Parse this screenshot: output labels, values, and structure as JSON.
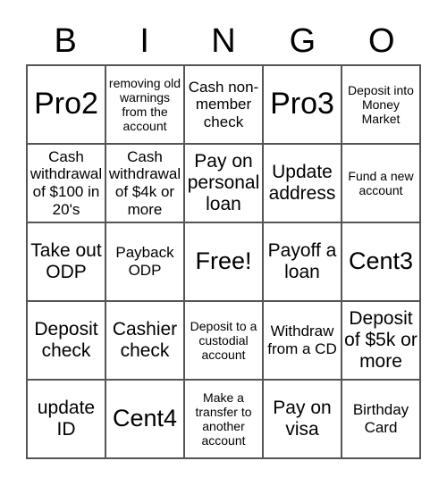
{
  "header": [
    "B",
    "I",
    "N",
    "G",
    "O"
  ],
  "cells": [
    [
      "Pro2",
      "removing old warnings from the account",
      "Cash non-member check",
      "Pro3",
      "Deposit into Money Market"
    ],
    [
      "Cash withdrawal of $100 in 20's",
      "Cash withdrawal of $4k or more",
      "Pay on personal loan",
      "Update address",
      "Fund a new account"
    ],
    [
      "Take out ODP",
      "Payback ODP",
      "Free!",
      "Payoff a loan",
      "Cent3"
    ],
    [
      "Deposit check",
      "Cashier check",
      "Deposit to a custodial account",
      "Withdraw from a CD",
      "Deposit of $5k or more"
    ],
    [
      "update ID",
      "Cent4",
      "Make a transfer to another account",
      "Pay on visa",
      "Birthday Card"
    ]
  ]
}
